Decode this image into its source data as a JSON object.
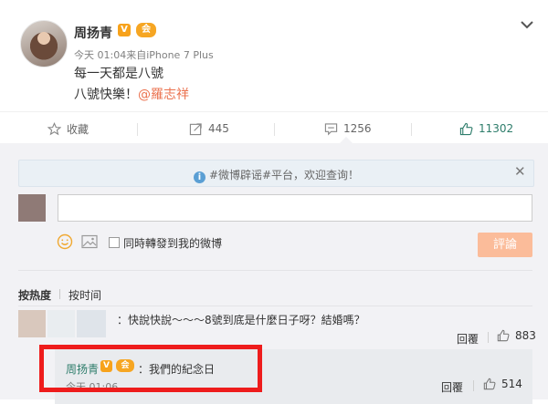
{
  "post": {
    "author": "周扬青",
    "verified_mark": "V",
    "member_mark": "会",
    "meta": "今天 01:04来自iPhone 7 Plus",
    "line1": "每一天都是八號",
    "line2_prefix": "八號快樂！",
    "line2_mention": "@羅志祥"
  },
  "actions": {
    "favorite_label": "收藏",
    "forward_count": "445",
    "comment_count": "1256",
    "like_count": "11302"
  },
  "notice": {
    "text": "#微博辟谣#平台，欢迎查询！",
    "close": "✕"
  },
  "composer": {
    "input_value": "",
    "repost_label": "同時轉發到我的微博",
    "submit_label": "評論"
  },
  "sort": {
    "hot_label": "按热度",
    "time_label": "按时间"
  },
  "comments": [
    {
      "text": "：快說快說～～～8號到底是什麼日子呀？結婚嗎？",
      "reply_label": "回覆",
      "like_count": "883",
      "replies": [
        {
          "author": "周扬青",
          "text": "：我們的紀念日",
          "time": "今天 01:06",
          "reply_label": "回覆",
          "like_count": "514"
        }
      ]
    }
  ],
  "colors": {
    "accent_orange": "#eb7350",
    "link_green": "#2e7d6b",
    "highlight_red": "#ee1c1c",
    "submit_disabled": "#fbbc9a"
  }
}
